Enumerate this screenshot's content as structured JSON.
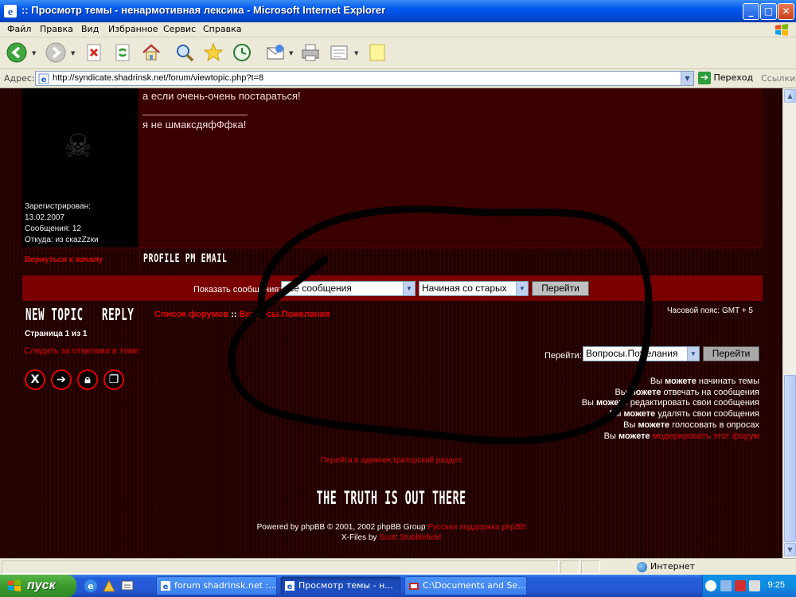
{
  "window": {
    "title": ":: Просмотр темы - ненармотивная лексика - Microsoft Internet Explorer",
    "btn_min": "_",
    "btn_max": "□",
    "btn_close": "✕"
  },
  "menu": [
    "Файл",
    "Правка",
    "Вид",
    "Избранное",
    "Сервис",
    "Справка"
  ],
  "address": {
    "label": "Адрес:",
    "url": "http://syndicate.shadrinsk.net/forum/viewtopic.php?t=8",
    "go_label": "Переход",
    "links_label": "Ссылки"
  },
  "post": {
    "line1": "а если очень-очень постараться!",
    "signature": "я не шмаксдяфФфка!",
    "poster_info": [
      "Зарегистрирован:",
      "13.02.2007",
      "Сообщения: 12",
      "Откуда: из скаzZzки"
    ],
    "back_to_top": "Вернуться к началу",
    "buttons": "PROFILE PM EMAIL"
  },
  "show_bar": {
    "label": "Показать сообщения:",
    "select1": "все сообщения",
    "select2": "Начиная со старых",
    "go": "Перейти"
  },
  "nav": {
    "new_topic": "NEW TOPIC",
    "reply": "REPLY",
    "crumb_root": "Список форумов",
    "crumb_sep": "::",
    "crumb_forum": "Вопросы.Пожелания",
    "timezone": "Часовой пояс: GMT + 5",
    "page_of": "Страница 1 из 1",
    "watch": "Следить за ответами в теме",
    "jump_label": "Перейти:",
    "jump_select": "Вопросы.Пожелания",
    "jump_go": "Перейти"
  },
  "perms": [
    {
      "pre": "Вы ",
      "bold": "можете",
      "post": " начинать темы",
      "link": ""
    },
    {
      "pre": "Вы ",
      "bold": "можете",
      "post": " отвечать на сообщения",
      "link": ""
    },
    {
      "pre": "Вы ",
      "bold": "можете",
      "post": " редактировать свои сообщения",
      "link": ""
    },
    {
      "pre": "Вы ",
      "bold": "можете",
      "post": " удалять свои сообщения",
      "link": ""
    },
    {
      "pre": "Вы ",
      "bold": "можете",
      "post": " голосовать в опросах",
      "link": ""
    },
    {
      "pre": "Вы ",
      "bold": "можете",
      "post": " ",
      "link": "модерировать этот форум"
    }
  ],
  "footer": {
    "admin_link": "Перейти в администраторский раздел",
    "truth": "THE TRUTH IS OUT THERE",
    "powered_pre": "Powered by phpBB © 2001, 2002 phpBB Group",
    "powered_link": "Русская поддержка phpBB",
    "xfiles_pre": "X-Files by",
    "xfiles_link": "Scott Stubblefield"
  },
  "status": {
    "zone": "Интернет"
  },
  "taskbar": {
    "start": "пуск",
    "tasks": [
      "forum shadrinsk.net :...",
      "Просмотр темы - н...",
      "C:\\Documents and Se..."
    ],
    "clock": "9:25"
  },
  "colors": {
    "link_red": "#e00000",
    "bar_red": "#7a0000",
    "post_bg": "#3a0000"
  },
  "icons": {
    "mod": [
      "delete-topic-icon",
      "move-topic-icon",
      "lock-topic-icon",
      "split-topic-icon"
    ]
  }
}
